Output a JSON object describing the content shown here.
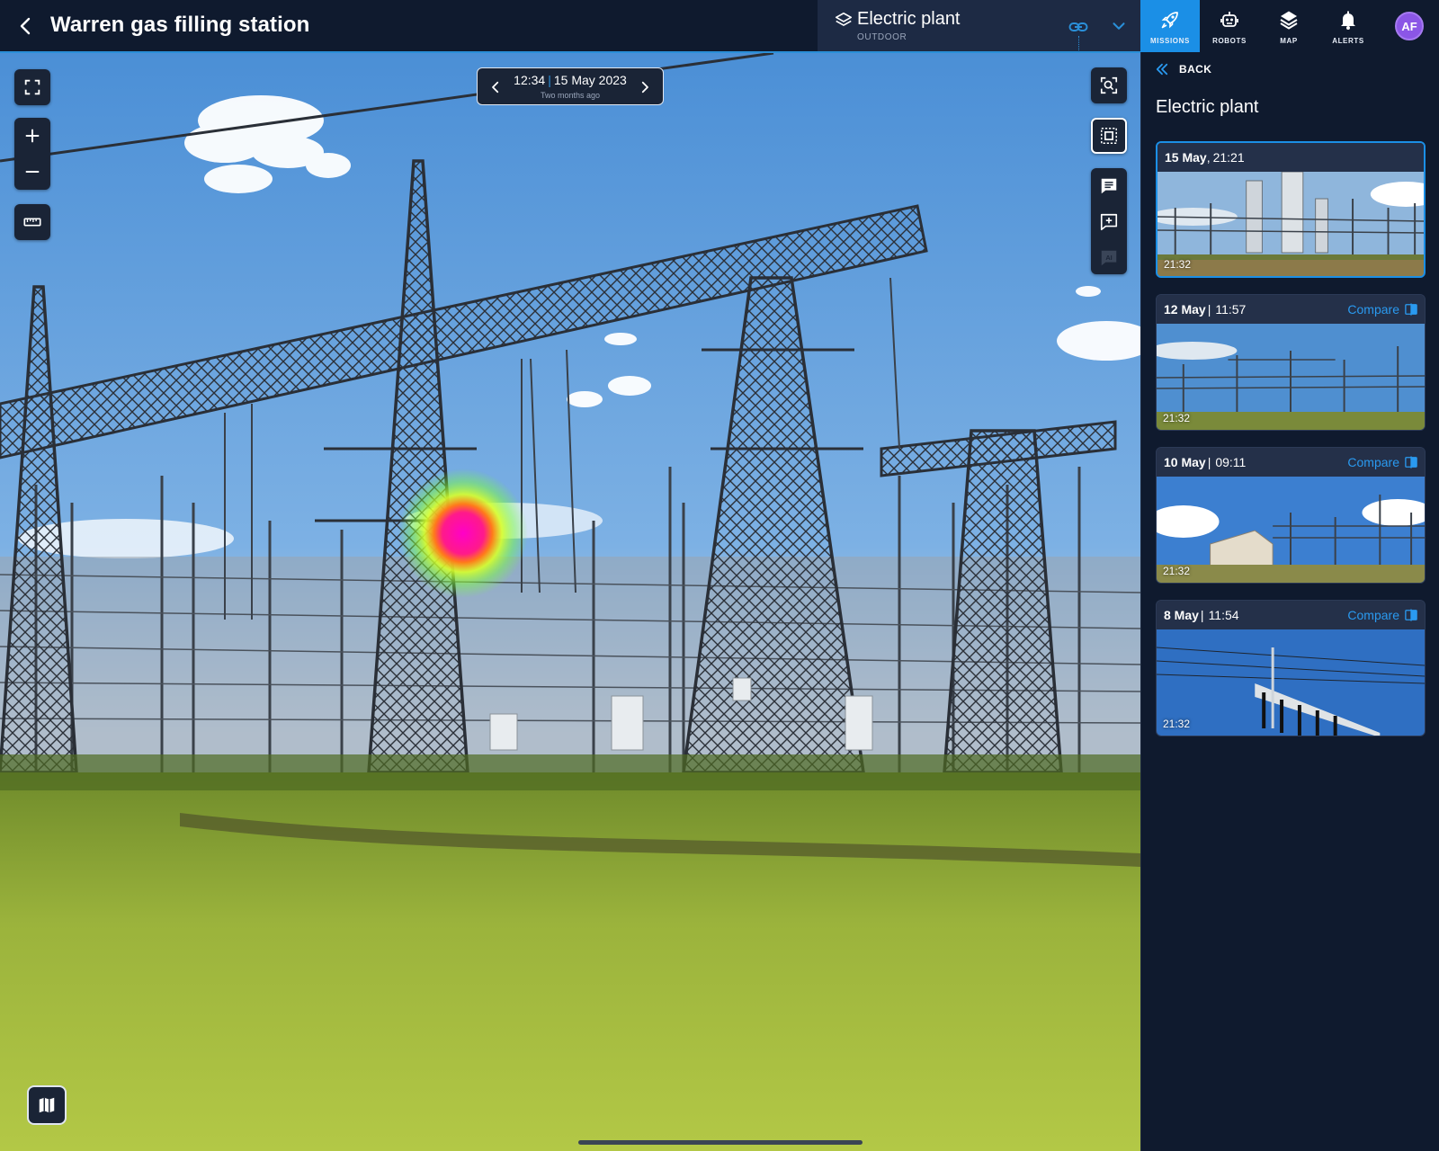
{
  "header": {
    "title": "Warren gas filling station",
    "layer": {
      "name": "Electric plant",
      "type": "OUTDOOR"
    }
  },
  "nav": {
    "items": [
      {
        "label": "MISSIONS",
        "icon": "rocket-icon",
        "active": true
      },
      {
        "label": "ROBOTS",
        "icon": "robot-icon",
        "active": false
      },
      {
        "label": "MAP",
        "icon": "layers-icon",
        "active": false
      },
      {
        "label": "ALERTS",
        "icon": "bell-icon",
        "active": false
      }
    ],
    "avatar_initials": "AF"
  },
  "viewer": {
    "time": "12:34",
    "date": "15 May 2023",
    "relative": "Two months ago",
    "tools": [
      "fullscreen-icon",
      "zoom-in-icon",
      "zoom-out-icon",
      "ruler-icon",
      "focus-search-icon",
      "frame-select-icon",
      "comments-list-icon",
      "add-comment-icon",
      "ai-icon",
      "map-icon"
    ]
  },
  "panel": {
    "back_label": "BACK",
    "title": "Electric plant",
    "compare_label": "Compare",
    "cards": [
      {
        "date": "15 May",
        "sep": ",",
        "time": "21:21",
        "stamp": "21:32",
        "active": true
      },
      {
        "date": "12 May",
        "sep": "|",
        "time": "11:57",
        "stamp": "21:32",
        "active": false
      },
      {
        "date": "10 May",
        "sep": "|",
        "time": "09:11",
        "stamp": "21:32",
        "active": false
      },
      {
        "date": "8 May",
        "sep": "|",
        "time": "11:54",
        "stamp": "21:32",
        "active": false
      }
    ]
  },
  "colors": {
    "accent": "#1b8fe6",
    "avatar": "#8b56e6",
    "background": "#0f1a2e"
  }
}
